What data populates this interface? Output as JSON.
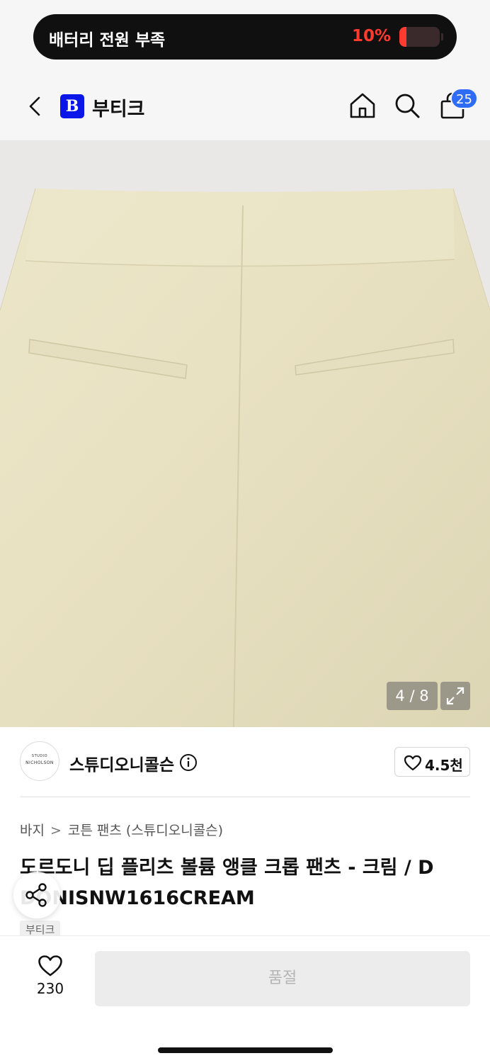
{
  "status_banner": {
    "label": "배터리 전원 부족",
    "percent": "10%",
    "battery_level": 0.1,
    "accent_color": "#ff3b30"
  },
  "header": {
    "back_icon": "chevron-left-icon",
    "logo_letter": "B",
    "brand_color": "#0a17e8",
    "store_name": "부티크",
    "icons": [
      "home-icon",
      "search-icon",
      "shopping-bag-icon"
    ],
    "cart_badge": "25",
    "badge_color": "#2e6cf5"
  },
  "gallery": {
    "counter": "4 / 8",
    "expand_icon": "expand-icon"
  },
  "brand": {
    "avatar_line1": "STUDIO",
    "avatar_line2": "NICHOLSON",
    "name": "스튜디오니콜슨",
    "info_icon": "info-icon",
    "like_icon": "heart-icon",
    "like_count": "4.5천"
  },
  "breadcrumb": {
    "category": "바지",
    "separator": ">",
    "subcategory": "코튼 팬츠 (스튜디오니콜슨)"
  },
  "product": {
    "title_line1": "도르도니 딥 플리츠 볼륨 앵클 크롭 팬츠 - 크림 / D",
    "title_line2": "DONISNW1616CREAM",
    "store_tag": "부티크",
    "share_icon": "share-icon"
  },
  "bottom_bar": {
    "wish_icon": "heart-icon",
    "wish_count": "230",
    "soldout_label": "품절"
  }
}
